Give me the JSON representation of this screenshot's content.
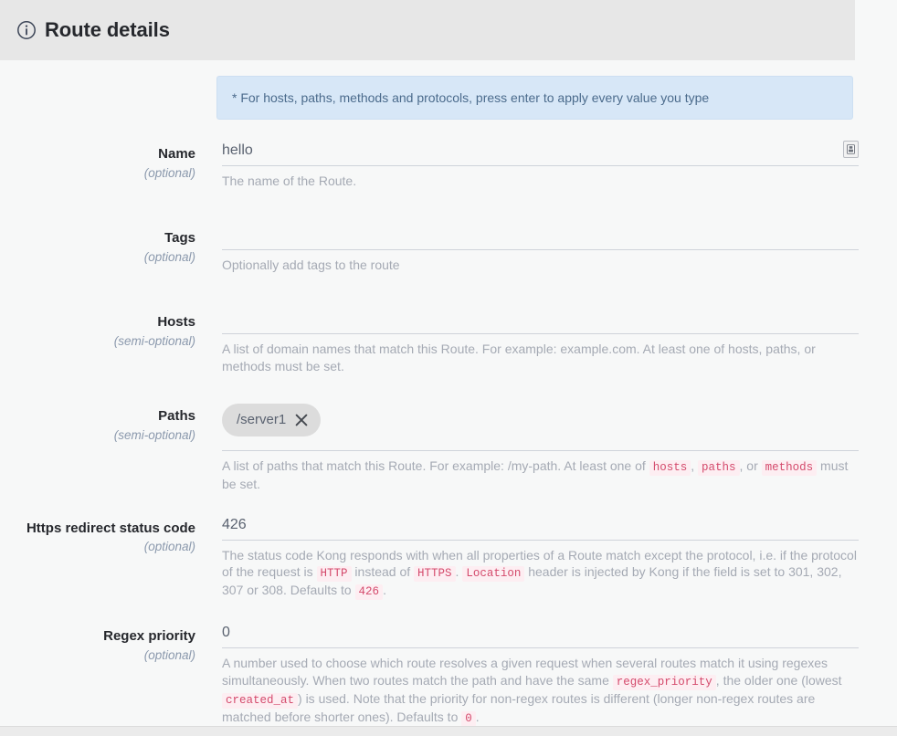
{
  "header": {
    "title": "Route details",
    "icon": "info-circle-icon"
  },
  "notice": {
    "text": "* For hosts, paths, methods and protocols, press enter to apply every value you type",
    "bg_color": "#d7e7f7",
    "text_color": "#4b6b8c"
  },
  "fields": {
    "name": {
      "label": "Name",
      "sublabel": "(optional)",
      "value": "hello",
      "placeholder": "",
      "help": "The name of the Route.",
      "vault_icon": "vault-secret-icon"
    },
    "tags": {
      "label": "Tags",
      "sublabel": "(optional)",
      "value": "",
      "placeholder": "",
      "help": "Optionally add tags to the route"
    },
    "hosts": {
      "label": "Hosts",
      "sublabel": "(semi-optional)",
      "value": "",
      "placeholder": "",
      "help_part1": "A list of domain names that match this Route. For example: example.com. At least one of hosts, paths, or methods must be set."
    },
    "paths": {
      "label": "Paths",
      "sublabel": "(semi-optional)",
      "chips": [
        {
          "label": "/server1",
          "remove_icon": "close-icon"
        }
      ],
      "help_prefix": "A list of paths that match this Route. For example: /my-path. At least one of ",
      "help_code1": "hosts",
      "help_sep1": ", ",
      "help_code2": "paths",
      "help_sep2": ", or ",
      "help_code3": "methods",
      "help_suffix": " must be set."
    },
    "https_redirect_status_code": {
      "label": "Https redirect status code",
      "sublabel": "(optional)",
      "value": "426",
      "placeholder": "",
      "help_prefix": "The status code Kong responds with when all properties of a Route match except the protocol, i.e. if the protocol of the request is ",
      "help_code1": "HTTP",
      "help_mid1": " instead of ",
      "help_code2": "HTTPS",
      "help_mid2": ". ",
      "help_code3": "Location",
      "help_mid3": " header is injected by Kong if the field is set to 301, 302, 307 or 308. Defaults to ",
      "help_code4": "426",
      "help_suffix": "."
    },
    "regex_priority": {
      "label": "Regex priority",
      "sublabel": "(optional)",
      "value": "0",
      "placeholder": "",
      "help_prefix": "A number used to choose which route resolves a given request when several routes match it using regexes simultaneously. When two routes match the path and have the same ",
      "help_code1": "regex_priority",
      "help_mid1": ", the older one (lowest ",
      "help_code2": "created_at",
      "help_mid2": ") is used. Note that the priority for non-regex routes is different (longer non-regex routes are matched before shorter ones). Defaults to ",
      "help_code3": "0",
      "help_suffix": "."
    }
  },
  "colors": {
    "page_bg": "#f7f8f8",
    "header_bg": "#e7e7e7",
    "label": "#26282d",
    "sublabel": "#8b99ad",
    "help": "#a5aab4",
    "code_text": "#d44a6c",
    "code_bg": "#fdeef2",
    "input_underline": "#cfd3da",
    "chip_bg": "#dcdcdc"
  }
}
